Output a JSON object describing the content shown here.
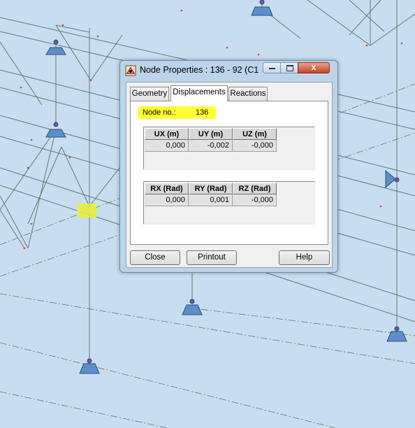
{
  "dialog": {
    "title": "Node Properties : 136 - 92 (C1...",
    "tabs": [
      {
        "label": "Geometry",
        "active": false
      },
      {
        "label": "Displacements",
        "active": true
      },
      {
        "label": "Reactions",
        "active": false
      }
    ],
    "node_label": "Node no.:",
    "node_value": "136",
    "displacements": {
      "headers": [
        "UX (m)",
        "UY (m)",
        "UZ (m)"
      ],
      "values": [
        "0,000",
        "-0,002",
        "-0,000"
      ]
    },
    "rotations": {
      "headers": [
        "RX (Rad)",
        "RY (Rad)",
        "RZ (Rad)"
      ],
      "values": [
        "0,000",
        "0,001",
        "-0,000"
      ]
    },
    "buttons": {
      "close": "Close",
      "printout": "Printout",
      "help": "Help"
    },
    "close_glyph": "x"
  },
  "colors": {
    "viewport_bg": "#c8ddef",
    "highlight": "#ffff33",
    "support": "#5b8fc9"
  }
}
